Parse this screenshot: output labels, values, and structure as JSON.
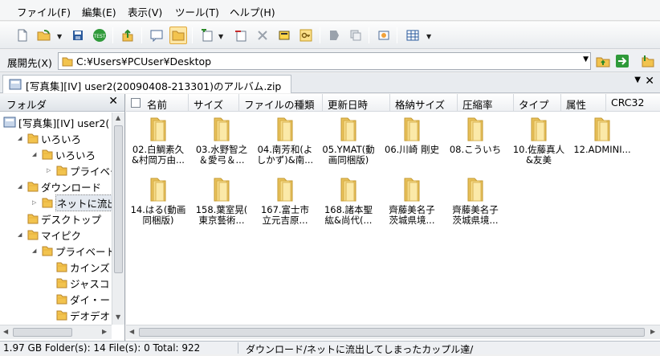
{
  "menu": [
    "ファイル(F)",
    "編集(E)",
    "表示(V)",
    "ツール(T)",
    "ヘルプ(H)"
  ],
  "toolbar_icons": [
    "new-icon",
    "open-icon",
    "save-icon",
    "test-icon",
    "up-icon",
    "comment-icon",
    "folder-open-icon",
    "add-icon",
    "delete-icon",
    "close-x-icon",
    "stamp-icon",
    "key-icon",
    "tag-icon",
    "copy-icon",
    "view-icon",
    "grid-icon"
  ],
  "address": {
    "label": "展開先(X)",
    "path": "C:¥Users¥PCUser¥Desktop"
  },
  "tab": {
    "title": "[写真集][IV] user2(20090408-213301)のアルバム.zip"
  },
  "folder_pane": {
    "title": "フォルダ",
    "tree": [
      {
        "label": "[写真集][IV] user2(",
        "level": 0
      },
      {
        "label": "いろいろ",
        "level": 1
      },
      {
        "label": "いろいろ",
        "level": 2
      },
      {
        "label": "プライベー",
        "level": 3
      },
      {
        "label": "ダウンロード",
        "level": 1
      },
      {
        "label": "ネットに流出",
        "level": 2
      },
      {
        "label": "デスクトップ",
        "level": 1
      },
      {
        "label": "マイピク",
        "level": 1
      },
      {
        "label": "プライベート",
        "level": 2
      },
      {
        "label": "カインズ",
        "level": 3
      },
      {
        "label": "ジャスコ",
        "level": 3
      },
      {
        "label": "ダイ・ー",
        "level": 3
      },
      {
        "label": "デオデオ",
        "level": 3
      }
    ]
  },
  "columns": [
    "名前",
    "サイズ",
    "ファイルの種類",
    "更新日時",
    "格納サイズ",
    "圧縮率",
    "タイプ",
    "属性",
    "CRC32"
  ],
  "files": [
    {
      "name": "02.白鯛素久\n&村岡万由..."
    },
    {
      "name": "03.水野智之\n＆愛弓＆..."
    },
    {
      "name": "04.南芳和(よ\nしかず)&南..."
    },
    {
      "name": "05.YMAT(動\n画同梱版)"
    },
    {
      "name": "06.川崎 剛史"
    },
    {
      "name": "08.こういち"
    },
    {
      "name": "10.佐藤真人\n&友美"
    },
    {
      "name": "12.ADMINI..."
    },
    {
      "name": "14.はる(動画\n同梱版)"
    },
    {
      "name": "158.葉室晃(\n東京藝術..."
    },
    {
      "name": "167.富士市\n立元吉原..."
    },
    {
      "name": "168.諸本聖\n紘&尚代(..."
    },
    {
      "name": "齊藤美名子\n茨城県境..."
    },
    {
      "name": "齊藤美名子\n茨城県境..."
    }
  ],
  "status": {
    "left": "1.97 GB  Folder(s): 14  File(s): 0  Total: 922",
    "right": "ダウンロード/ネットに流出してしまったカップル達/"
  }
}
